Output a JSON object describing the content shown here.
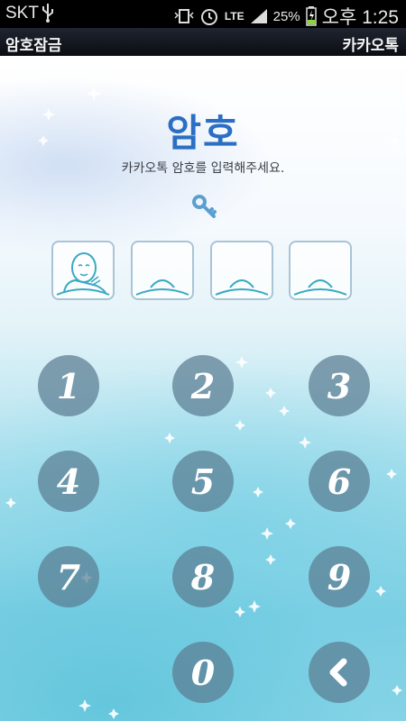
{
  "status_bar": {
    "carrier": "SKT",
    "network": "LTE",
    "battery": "25%",
    "time": "오후 1:25",
    "icons": [
      "usb-icon",
      "vibrate-icon",
      "alarm-icon",
      "signal-icon",
      "battery-charging-icon"
    ]
  },
  "title_bar": {
    "left": "암호잠금",
    "right": "카카오톡"
  },
  "main": {
    "title": "암호",
    "subtitle": "카카오톡 암호를 입력해주세요.",
    "pin_slots": [
      {
        "state": "filled"
      },
      {
        "state": "empty"
      },
      {
        "state": "empty"
      },
      {
        "state": "empty"
      }
    ]
  },
  "keypad": {
    "keys": [
      "1",
      "2",
      "3",
      "4",
      "5",
      "6",
      "7",
      "8",
      "9",
      "0"
    ],
    "backspace": "backspace-icon"
  },
  "colors": {
    "title": "#2b6fc4",
    "key_bg": "#5a7d91",
    "slot_border": "#a9c4d6"
  }
}
